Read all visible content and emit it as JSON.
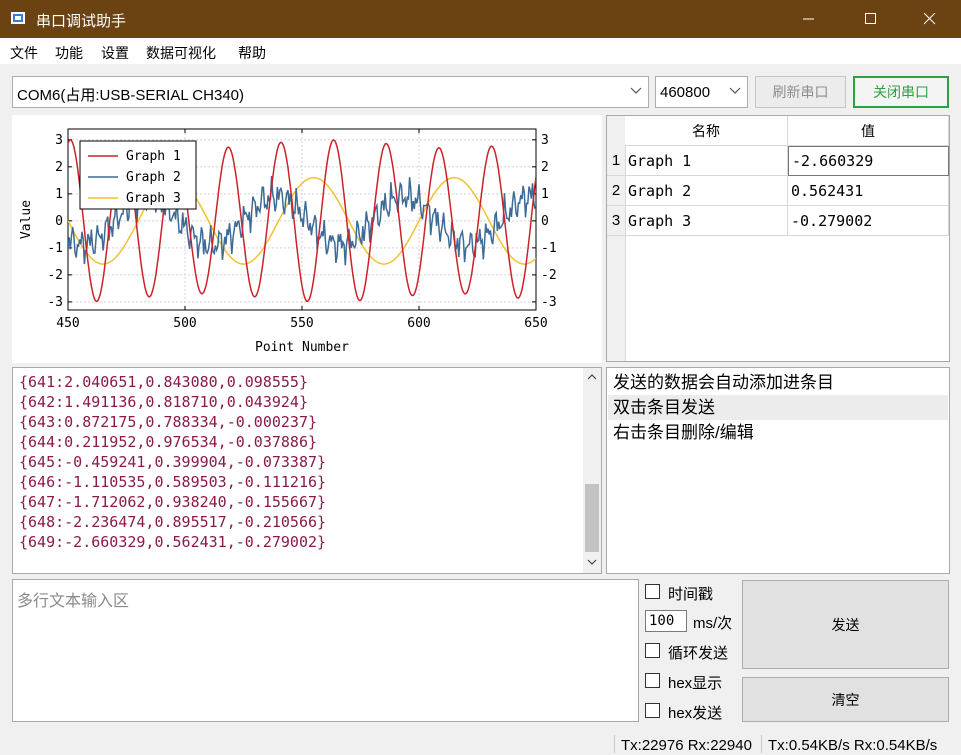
{
  "window": {
    "title": "串口调试助手"
  },
  "menu": [
    "文件",
    "功能",
    "设置",
    "数据可视化",
    "帮助"
  ],
  "toolbar": {
    "port": "COM6(占用:USB-SERIAL CH340)",
    "baud": "460800",
    "refresh_label": "刷新串口",
    "close_label": "关闭串口"
  },
  "colors": {
    "graph1": "#cc2229",
    "graph2": "#3d6b96",
    "graph3": "#f2c22e",
    "titlebar": "#6b4212",
    "close_btn_border": "#2ea043"
  },
  "chart_data": {
    "type": "line",
    "xlabel": "Point Number",
    "ylabel": "Value",
    "xlim": [
      450,
      650
    ],
    "ylim": [
      -3.3,
      3.4
    ],
    "x_ticks": [
      450,
      500,
      550,
      600,
      650
    ],
    "y_ticks": [
      3,
      2,
      1,
      0,
      -1,
      -2,
      -3
    ],
    "grid": true,
    "legend_position": "top-left",
    "series": [
      {
        "name": "Graph 1",
        "color": "#cc2229"
      },
      {
        "name": "Graph 2",
        "color": "#3d6b96"
      },
      {
        "name": "Graph 3",
        "color": "#f2c22e"
      }
    ]
  },
  "table": {
    "headers": [
      "名称",
      "值"
    ],
    "rows": [
      {
        "index": "1",
        "name": "Graph 1",
        "value": "-2.660329"
      },
      {
        "index": "2",
        "name": "Graph 2",
        "value": "0.562431"
      },
      {
        "index": "3",
        "name": "Graph 3",
        "value": "-0.279002"
      }
    ]
  },
  "log": [
    "{641:2.040651,0.843080,0.098555}",
    "{642:1.491136,0.818710,0.043924}",
    "{643:0.872175,0.788334,-0.000237}",
    "{644:0.211952,0.976534,-0.037886}",
    "{645:-0.459241,0.399904,-0.073387}",
    "{646:-1.110535,0.589503,-0.111216}",
    "{647:-1.712062,0.938240,-0.155667}",
    "{648:-2.236474,0.895517,-0.210566}",
    "{649:-2.660329,0.562431,-0.279002}"
  ],
  "send_list": [
    "发送的数据会自动添加进条目",
    "双击条目发送",
    "右击条目删除/编辑"
  ],
  "input": {
    "placeholder": "多行文本输入区"
  },
  "options": {
    "timestamp_label": "时间戳",
    "interval_value": "100",
    "interval_unit": "ms/次",
    "loop_label": "循环发送",
    "hex_show_label": "hex显示",
    "hex_send_label": "hex发送"
  },
  "buttons": {
    "send_label": "发送",
    "clear_label": "清空"
  },
  "status": {
    "counts": "Tx:22976 Rx:22940",
    "rates": "Tx:0.54KB/s Rx:0.54KB/s"
  }
}
